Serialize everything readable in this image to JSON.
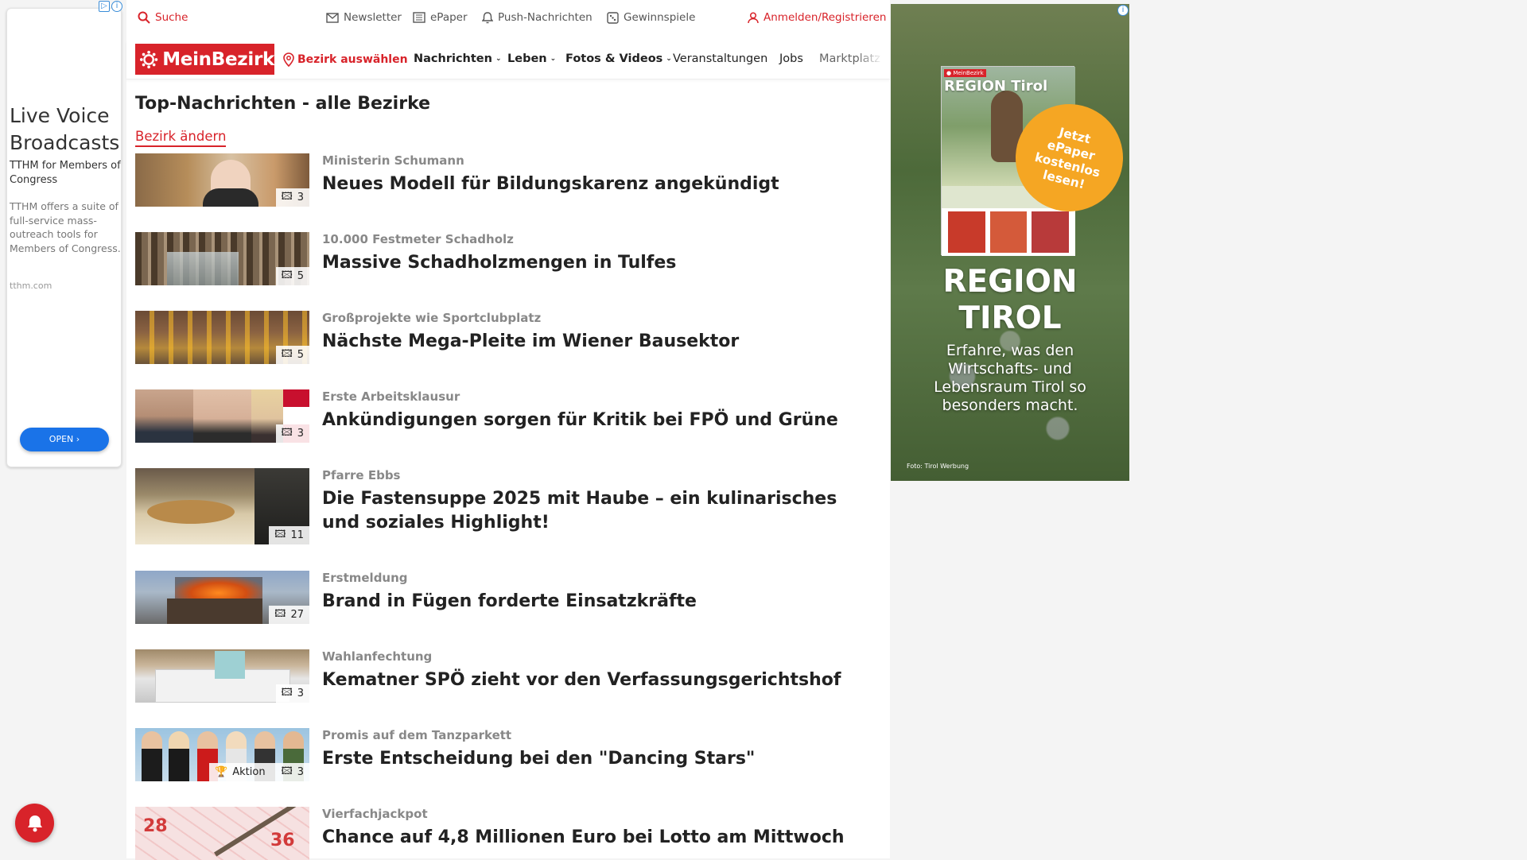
{
  "left_ad": {
    "headline": "Live Voice Broadcasts",
    "advertiser": "TTHM for Members of Congress",
    "body": "TTHM offers a suite of full-service mass-outreach tools for Members of Congress.",
    "domain": "tthm.com",
    "open_label": "OPEN",
    "button_color": "#1a73e8"
  },
  "top_bar": {
    "search": "Suche",
    "newsletter": "Newsletter",
    "epaper": "ePaper",
    "push": "Push-Nachrichten",
    "games": "Gewinnspiele",
    "login": "Anmelden/Registrieren"
  },
  "nav": {
    "logo": "MeinBezirk",
    "district_select": "Bezirk auswählen",
    "items": [
      "Nachrichten",
      "Leben",
      "Fotos & Videos",
      "Veranstaltungen",
      "Jobs",
      "Marktplatz"
    ]
  },
  "brand_color": "#d8232a",
  "page_title": "Top-Nachrichten - alle Bezirke",
  "change_district": "Bezirk ändern",
  "articles": [
    {
      "kicker": "Ministerin Schumann",
      "headline": "Neues Modell für Bildungskarenz angekündigt",
      "photos": "3"
    },
    {
      "kicker": "10.000 Festmeter Schadholz",
      "headline": "Massive Schadholzmengen in Tulfes",
      "photos": "5"
    },
    {
      "kicker": "Großprojekte wie Sportclubplatz",
      "headline": "Nächste Mega-Pleite im Wiener Bausektor",
      "photos": "5"
    },
    {
      "kicker": "Erste Arbeitsklausur",
      "headline": "Ankündigungen sorgen für Kritik bei FPÖ und Grüne",
      "photos": "3"
    },
    {
      "kicker": "Pfarre Ebbs",
      "headline": "Die Fastensuppe 2025 mit Haube – ein kulinarisches und soziales Highlight!",
      "photos": "11"
    },
    {
      "kicker": "Erstmeldung",
      "headline": "Brand in Fügen forderte Einsatzkräfte",
      "photos": "27"
    },
    {
      "kicker": "Wahlanfechtung",
      "headline": "Kematner SPÖ zieht vor den Verfassungsgerichtshof",
      "photos": "3"
    },
    {
      "kicker": "Promis auf dem Tanzparkett",
      "headline": "Erste Entscheidung bei den \"Dancing Stars\"",
      "photos": "3",
      "extra_badge": "Aktion"
    },
    {
      "kicker": "Vierfachjackpot",
      "headline": "Chance auf 4,8 Millionen Euro bei Lotto am Mittwoch",
      "photos": ""
    }
  ],
  "right_ad": {
    "mag_title": "REGION Tirol",
    "promo": "Jetzt ePaper kostenlos lesen!",
    "big_title_1": "REGION",
    "big_title_2": "TIROL",
    "tagline": "Erfahre, was den Wirtschafts- und Lebensraum Tirol so besonders macht.",
    "credit": "Foto: Tirol Werbung",
    "promo_color": "#f5a623"
  }
}
